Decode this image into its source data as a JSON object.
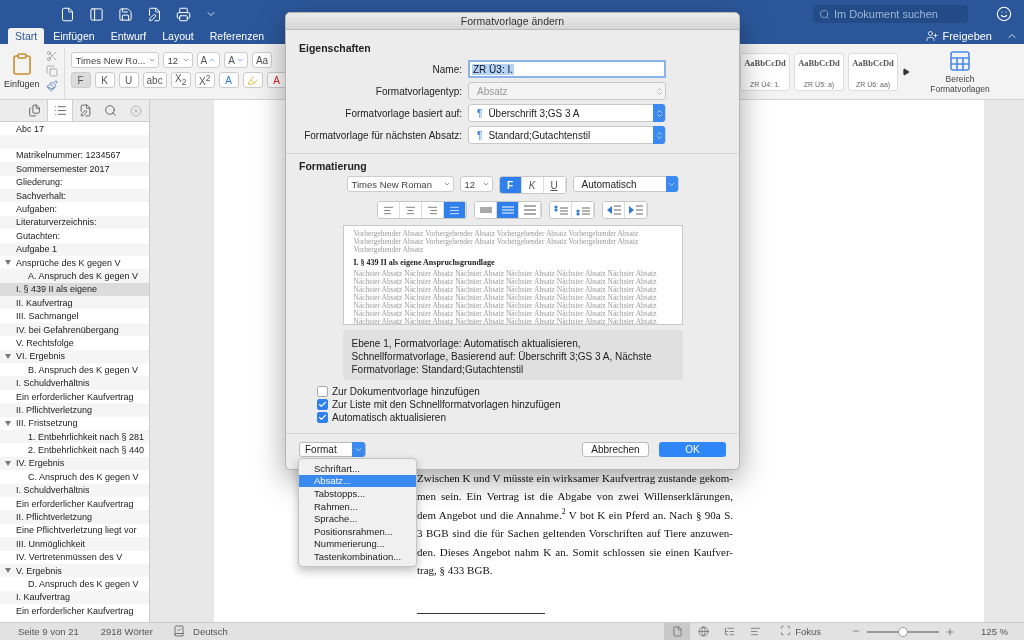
{
  "title_bar": {
    "search": {
      "placeholder": "Im Dokument suchen"
    }
  },
  "ribbon_tabs": [
    {
      "label": "Start",
      "selected": true
    },
    {
      "label": "Einfügen",
      "selected": false
    },
    {
      "label": "Entwurf",
      "selected": false
    },
    {
      "label": "Layout",
      "selected": false
    },
    {
      "label": "Referenzen",
      "selected": false
    }
  ],
  "share_button": {
    "label": "Freigeben"
  },
  "ribbon": {
    "paste_label": "Einfügen",
    "font_name": "Times New Ro...",
    "font_size": "12",
    "grow_font": "A",
    "shrink_font": "A",
    "change_case": "Aa",
    "format_buttons": [
      {
        "label": "F",
        "selected": true
      },
      {
        "label": "K",
        "selected": false
      },
      {
        "label": "U",
        "selected": false
      },
      {
        "label": "abc",
        "selected": false
      },
      {
        "label": "X$_{2}$",
        "selected": false
      },
      {
        "label": "X$^{2}$",
        "selected": false
      }
    ],
    "text_effects": "A",
    "font_color": "A",
    "styles": [
      {
        "sample": "AaBbCcDd",
        "name": "ZR Ü4: 1."
      },
      {
        "sample": "AaBbCcDd",
        "name": "ZR Ü5: a)"
      },
      {
        "sample": "AaBbCcDd",
        "name": "ZR Ü6: aa)"
      }
    ],
    "styles_pane": "Bereich Formatvorlagen"
  },
  "sidebar": {
    "tabs": [
      {
        "kind": "pages",
        "selected": false
      },
      {
        "kind": "outline",
        "selected": true
      },
      {
        "kind": "edit",
        "selected": false
      },
      {
        "kind": "search",
        "selected": false
      }
    ],
    "items": [
      {
        "kind": "entry",
        "label": "Abc 17",
        "selected": false
      },
      {
        "kind": "blank",
        "selected": false
      },
      {
        "kind": "entry",
        "label": "Matrikelnummer: 1234567",
        "selected": false
      },
      {
        "kind": "entry",
        "label": "Sommersemester 2017",
        "selected": false
      },
      {
        "kind": "entry",
        "label": "Gliederung:",
        "selected": false
      },
      {
        "kind": "entry",
        "label": "Sachverhalt:",
        "selected": false
      },
      {
        "kind": "entry",
        "label": "Aufgaben:",
        "selected": false
      },
      {
        "kind": "entry",
        "label": "Literaturverzeichnis:",
        "selected": false
      },
      {
        "kind": "entry",
        "label": "Gutachten:",
        "selected": false
      },
      {
        "kind": "entry",
        "label": "Aufgabe 1",
        "selected": false
      },
      {
        "kind": "entry",
        "label": "Ansprüche des K gegen V",
        "selected": false,
        "expanded": true,
        "children": [
          {
            "kind": "entry",
            "label": "A. Anspruch des K gegen V",
            "selected": false
          }
        ]
      },
      {
        "kind": "entry",
        "label": "I. § 439 II als eigene",
        "selected": true
      },
      {
        "kind": "entry",
        "label": "II. Kaufvertrag",
        "selected": false
      },
      {
        "kind": "entry",
        "label": "III. Sachmangel",
        "selected": false
      },
      {
        "kind": "entry",
        "label": "IV. bei Gefahrenübergang",
        "selected": false
      },
      {
        "kind": "entry",
        "label": "V. Rechtsfolge",
        "selected": false
      },
      {
        "kind": "entry",
        "label": "VI. Ergebnis",
        "selected": false,
        "expanded": true,
        "children": [
          {
            "kind": "entry",
            "label": "B. Anspruch des K gegen V",
            "selected": false
          }
        ]
      },
      {
        "kind": "entry",
        "label": "I. Schuldverhältnis",
        "selected": false
      },
      {
        "kind": "entry",
        "label": "Ein erforderlicher Kaufvertrag",
        "selected": false
      },
      {
        "kind": "entry",
        "label": "II. Pflichtverletzung",
        "selected": false
      },
      {
        "kind": "entry",
        "label": "III. Fristsetzung",
        "selected": false,
        "expanded": true,
        "children": [
          {
            "kind": "entry",
            "label": "1. Entbehrlichkeit nach § 281",
            "selected": false
          },
          {
            "kind": "entry",
            "label": "2. Entbehrlichkeit nach § 440",
            "selected": false
          }
        ]
      },
      {
        "kind": "entry",
        "label": "IV. Ergebnis",
        "selected": false,
        "expanded": true,
        "children": [
          {
            "kind": "entry",
            "label": "C. Anspruch des K gegen V",
            "selected": false
          }
        ]
      },
      {
        "kind": "entry",
        "label": "I. Schuldverhältnis",
        "selected": false
      },
      {
        "kind": "entry",
        "label": "Ein erforderlicher Kaufvertrag",
        "selected": false
      },
      {
        "kind": "entry",
        "label": "II. Pflichtverletzung",
        "selected": false
      },
      {
        "kind": "entry",
        "label": "Eine Pflichtverletzung liegt vor",
        "selected": false
      },
      {
        "kind": "entry",
        "label": "III. Unmöglichkeit",
        "selected": false
      },
      {
        "kind": "entry",
        "label": "IV. Vertretenmüssen des V",
        "selected": false
      },
      {
        "kind": "entry",
        "label": "V. Ergebnis",
        "selected": false,
        "expanded": true,
        "children": [
          {
            "kind": "entry",
            "label": "D. Anspruch des K gegen V",
            "selected": false
          }
        ]
      },
      {
        "kind": "entry",
        "label": "I. Kaufvertrag",
        "selected": false
      },
      {
        "kind": "entry",
        "label": "Ein erforderlicher Kaufvertrag",
        "selected": false
      }
    ]
  },
  "document": {
    "lines": [
      "Zwischen K und V müsste ein wirksamer Kaufvertrag zustande gekom-",
      "men sein. Ein Vertrag ist die Abgabe von zwei Willenserklärungen,",
      "dem Angebot und die Annahme.$^{2}$ V bot K ein Pferd an. Nach § 90a S.",
      "3 BGB sind die für Sachen geltenden Vorschriften auf Tiere anzuwen-",
      "den. Dieses Angebot nahm K an. Somit schlossen sie einen Kaufver-",
      "trag, § 433 BGB."
    ]
  },
  "dialog": {
    "title": "Formatvorlage ändern",
    "properties_heading": "Eigenschaften",
    "fields": [
      {
        "kind": "text",
        "label": "Name:",
        "value": "ZR Ü3: I."
      },
      {
        "kind": "select",
        "label": "Formatvorlagentyp:",
        "value": "Absatz",
        "disabled": true
      },
      {
        "kind": "select",
        "label": "Formatvorlage basiert auf:",
        "value": "Überschrift 3;GS 3 A",
        "mark": "¶",
        "disabled": false
      },
      {
        "kind": "select",
        "label": "Formatvorlage für nächsten Absatz:",
        "value": "Standard;Gutachtenstil",
        "mark": "¶",
        "disabled": false
      }
    ],
    "formatting_heading": "Formatierung",
    "font": "Times New Roman",
    "size": "12",
    "styles": [
      {
        "label": "F",
        "selected": true
      },
      {
        "label": "K",
        "selected": false
      },
      {
        "label": "U",
        "selected": false
      }
    ],
    "font_color_value": "Automatisch",
    "alignment": [
      {
        "kind": "left",
        "selected": false
      },
      {
        "kind": "center",
        "selected": false
      },
      {
        "kind": "right",
        "selected": false
      },
      {
        "kind": "justify",
        "selected": true
      }
    ],
    "line_spacing": [
      {
        "kind": "single",
        "selected": false
      },
      {
        "kind": "one_half",
        "selected": true
      },
      {
        "kind": "double",
        "selected": false
      }
    ],
    "paragraph_spacing": [
      {
        "kind": "increase"
      },
      {
        "kind": "decrease"
      }
    ],
    "indent": [
      {
        "kind": "decrease"
      },
      {
        "kind": "increase"
      }
    ],
    "preview": {
      "previous": "Vorhergehender Absatz Vorhergehender Absatz Vorhergehender Absatz Vorhergehender Absatz Vorhergehender Absatz Vorhergehender Absatz Vorhergehender Absatz Vorhergehender Absatz Vorhergehender Absatz",
      "heading": "I. § 439 II als eigene Anspruchsgrundlage",
      "next": "Nächster Absatz Nächster Absatz Nächster Absatz Nächster Absatz Nächster Absatz Nächster Absatz Nächster Absatz Nächster Absatz Nächster Absatz Nächster Absatz Nächster Absatz Nächster Absatz Nächster Absatz Nächster Absatz Nächster Absatz Nächster Absatz Nächster Absatz Nächster Absatz Nächster Absatz Nächster Absatz Nächster Absatz Nächster Absatz Nächster Absatz Nächster Absatz Nächster Absatz Nächster Absatz Nächster Absatz Nächster Absatz Nächster Absatz Nächster Absatz Nächster Absatz Nächster Absatz Nächster Absatz Nächster Absatz Nächster Absatz Nächster Absatz Nächster Absatz Nächster Absatz Nächster Absatz Nächster Absatz Nächster Absatz Nächster Absatz"
    },
    "description": "Ebene 1, Formatvorlage: Automatisch aktualisieren, Schnellformatvorlage, Basierend auf: Überschrift 3;GS 3 A, Nächste Formatvorlage: Standard;Gutachtenstil",
    "options": [
      {
        "label": "Zur Dokumentvorlage hinzufügen",
        "checked": false
      },
      {
        "label": "Zur Liste mit den Schnellformatvorlagen hinzufügen",
        "checked": true
      },
      {
        "label": "Automatisch aktualisieren",
        "checked": true
      }
    ],
    "format_button": "Format",
    "cancel": "Abbrechen",
    "ok": "OK"
  },
  "format_menu": [
    {
      "label": "Schriftart...",
      "selected": false
    },
    {
      "label": "Absatz...",
      "selected": true
    },
    {
      "label": "Tabstopps...",
      "selected": false
    },
    {
      "label": "Rahmen...",
      "selected": false
    },
    {
      "label": "Sprache...",
      "selected": false
    },
    {
      "label": "Positionsrahmen...",
      "selected": false
    },
    {
      "label": "Nummerierung...",
      "selected": false
    },
    {
      "label": "Tastenkombination...",
      "selected": false
    }
  ],
  "status_bar": {
    "page": "Seite 9 von 21",
    "words": "2918 Wörter",
    "language": "Deutsch",
    "views": [
      {
        "kind": "print",
        "selected": true
      },
      {
        "kind": "web",
        "selected": false
      },
      {
        "kind": "outline",
        "selected": false
      },
      {
        "kind": "draft",
        "selected": false
      }
    ],
    "focus": "Fokus",
    "zoom": {
      "level": 0.5,
      "reading": "125 %"
    }
  }
}
